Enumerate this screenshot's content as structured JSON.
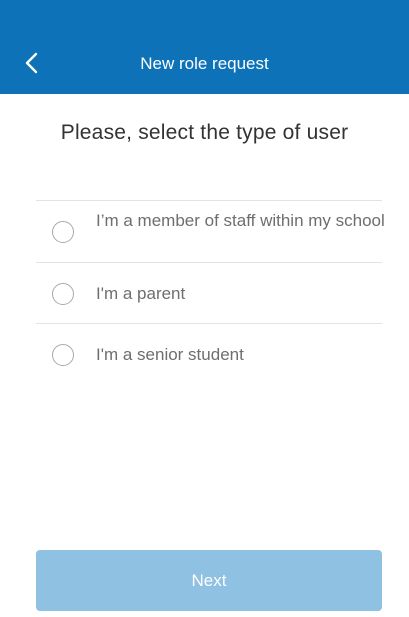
{
  "header": {
    "title": "New role request",
    "back_icon": "chevron-left-icon"
  },
  "main": {
    "heading": "Please, select the type of user",
    "options": [
      {
        "label": "I’m a member of staff within my school",
        "selected": false
      },
      {
        "label": "I'm a parent",
        "selected": false
      },
      {
        "label": "I'm a senior student",
        "selected": false
      }
    ]
  },
  "footer": {
    "next_label": "Next"
  },
  "colors": {
    "brand": "#0d72b8",
    "button_disabled": "#8ec1e2",
    "divider": "#e2e2e2",
    "option_text": "#6e6e6e"
  }
}
